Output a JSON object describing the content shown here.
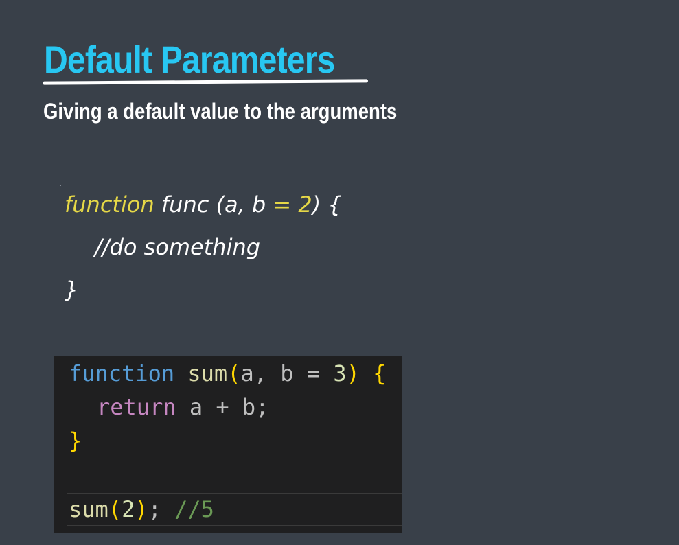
{
  "slide": {
    "title": "Default Parameters",
    "subtitle": "Giving a default value to the arguments"
  },
  "pseudo_code": {
    "line1": {
      "keyword": "function",
      "name_and_params": " func (a, b ",
      "equals": "=",
      "space": " ",
      "default_value": "2",
      "close": ") {"
    },
    "line2": "//do something",
    "line3": "}"
  },
  "code_editor": {
    "line1": {
      "keyword": "function",
      "space": " ",
      "fn_name": "sum",
      "open_paren": "(",
      "params": "a, b = ",
      "default_value": "3",
      "close_paren": ")",
      "space2": " ",
      "open_brace": "{"
    },
    "line2": {
      "keyword": "return",
      "expr": " a + b;"
    },
    "line3": "}",
    "line5": {
      "fn_name": "sum",
      "open_paren": "(",
      "arg": "2",
      "close_paren": ")",
      "semicolon": "; ",
      "comment": "//5"
    }
  },
  "colors": {
    "background": "#394049",
    "title": "#28c7f2",
    "pseudo_keyword": "#e6d847",
    "editor_background": "#1f1f20"
  }
}
